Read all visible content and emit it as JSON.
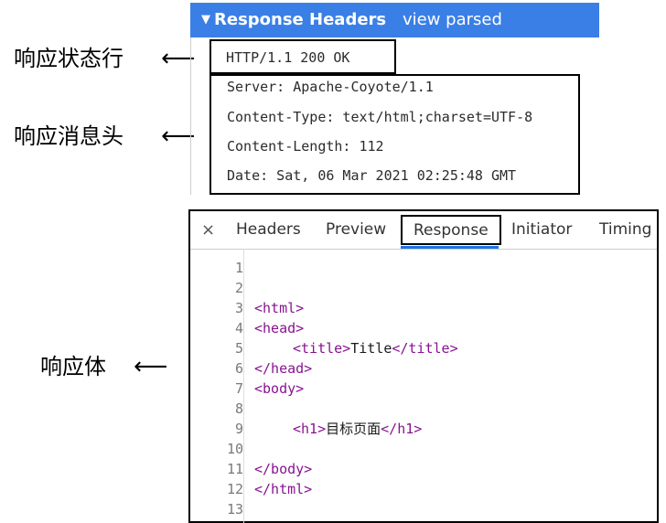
{
  "annotations": {
    "status_line": "响应状态行",
    "headers": "响应消息头",
    "body": "响应体",
    "arrow": "⟵"
  },
  "response_headers": {
    "title": "Response Headers",
    "toggle_link": "view parsed",
    "status_line": "HTTP/1.1 200 OK",
    "headers": [
      "Server: Apache-Coyote/1.1",
      "Content-Type: text/html;charset=UTF-8",
      "Content-Length: 112",
      "Date: Sat, 06 Mar 2021 02:25:48 GMT"
    ]
  },
  "devtools": {
    "close": "×",
    "tabs": [
      "Headers",
      "Preview",
      "Response",
      "Initiator",
      "Timing"
    ],
    "active_tab": "Response",
    "line_numbers": [
      "1",
      "2",
      "3",
      "4",
      "5",
      "6",
      "7",
      "8",
      "9",
      "10",
      "11",
      "12",
      "13"
    ],
    "code": {
      "l3": "<html>",
      "l4": "<head>",
      "l5_open": "<title>",
      "l5_text": "Title",
      "l5_close": "</title>",
      "l6": "</head>",
      "l7": "<body>",
      "l9_open": "<h1>",
      "l9_text": "目标页面",
      "l9_close": "</h1>",
      "l11": "</body>",
      "l12": "</html>"
    }
  }
}
